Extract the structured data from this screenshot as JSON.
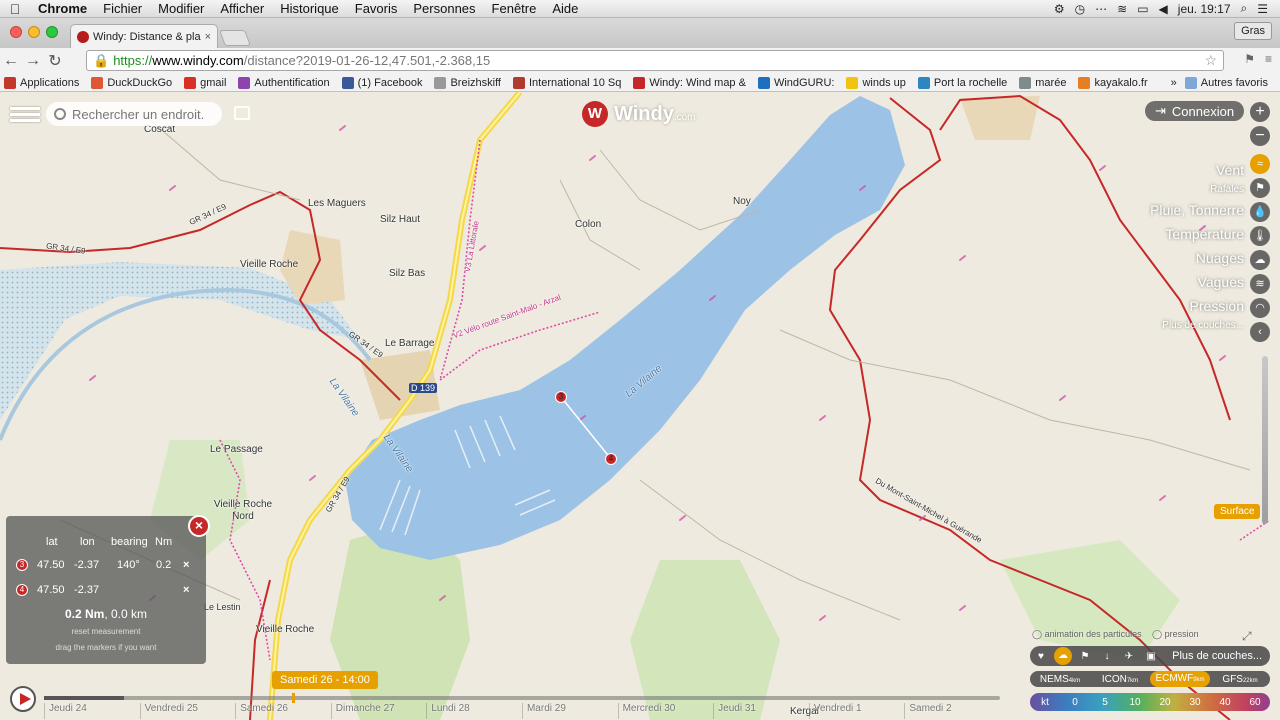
{
  "menubar": {
    "app": "Chrome",
    "items": [
      "Fichier",
      "Modifier",
      "Afficher",
      "Historique",
      "Favoris",
      "Personnes",
      "Fenêtre",
      "Aide"
    ],
    "clock": "jeu. 19:17"
  },
  "browser": {
    "tab_title": "Windy: Distance & planific",
    "profile_button": "Gras",
    "url_https": "https://",
    "url_host": "www.windy.com",
    "url_path": "/distance?2019-01-26-12,47.501,-2.368,15",
    "bookmarks": [
      {
        "label": "Applications",
        "color": "#c0392b"
      },
      {
        "label": "DuckDuckGo",
        "color": "#de5833"
      },
      {
        "label": "gmail",
        "color": "#d93025"
      },
      {
        "label": "Authentification",
        "color": "#8e44ad"
      },
      {
        "label": "(1) Facebook",
        "color": "#3b5998"
      },
      {
        "label": "Breizhskiff",
        "color": "#999999"
      },
      {
        "label": "International 10 Sq",
        "color": "#b03a2e"
      },
      {
        "label": "Windy: Wind map &",
        "color": "#c62828"
      },
      {
        "label": "WindGURU:",
        "color": "#1f6fbf"
      },
      {
        "label": "winds up",
        "color": "#f1c40f"
      },
      {
        "label": "Port la rochelle",
        "color": "#2e86c1"
      },
      {
        "label": "marée",
        "color": "#7f8c8d"
      },
      {
        "label": "kayakalo.fr",
        "color": "#e67e22"
      }
    ],
    "more_bookmarks": "»",
    "other_bookmarks": "Autres favoris"
  },
  "windy": {
    "search_placeholder": "Rechercher un endroit.",
    "logo_main": "Windy",
    "logo_suffix": ".com",
    "login": "Connexion",
    "layers": [
      {
        "label": "Vent",
        "small": false
      },
      {
        "label": "Rafales",
        "small": true
      },
      {
        "label": "Pluie, Tonnerre",
        "small": false
      },
      {
        "label": "Température",
        "small": false
      },
      {
        "label": "Nuages",
        "small": false
      },
      {
        "label": "Vagues",
        "small": false
      },
      {
        "label": "Pression",
        "small": false
      },
      {
        "label": "Plus de couches...",
        "small": true
      }
    ],
    "surface": "Surface",
    "measure": {
      "headers": {
        "lat": "lat",
        "lon": "lon",
        "bearing": "bearing",
        "nm": "Nm"
      },
      "rows": [
        {
          "n": "3",
          "lat": "47.50",
          "lon": "-2.37",
          "bearing": "140°",
          "nm": "0.2",
          "x": "×"
        },
        {
          "n": "4",
          "lat": "47.50",
          "lon": "-2.37",
          "bearing": "",
          "nm": "",
          "x": "×"
        }
      ],
      "total_nm": "0.2 Nm",
      "total_km": ", 0.0 km",
      "reset": "reset measurement",
      "drag": "drag the markers if you want",
      "close": "×"
    },
    "date_bubble": "Samedi 26 - 14:00",
    "days": [
      "Jeudi 24",
      "Vendredi 25",
      "Samedi 26",
      "Dimanche 27",
      "Lundi 28",
      "Mardi 29",
      "Mercredi 30",
      "Jeudi 31",
      "Vendredi 1",
      "Samedi 2"
    ],
    "particles_label": "animation des particules",
    "pressure_label": "pression",
    "more_layers": "Plus de couches...",
    "models": [
      {
        "name": "NEMS",
        "res": "4km",
        "active": false
      },
      {
        "name": "ICON",
        "res": "7km",
        "active": false
      },
      {
        "name": "ECMWF",
        "res": "9km",
        "active": true
      },
      {
        "name": "GFS",
        "res": "22km",
        "active": false
      }
    ],
    "scale_unit": "kt",
    "scale": [
      "0",
      "5",
      "10",
      "20",
      "30",
      "40",
      "60"
    ]
  },
  "map": {
    "places": [
      {
        "label": "Coscat"
      },
      {
        "label": "Les Maguers"
      },
      {
        "label": "Silz Haut"
      },
      {
        "label": "Colon"
      },
      {
        "label": "Noy"
      },
      {
        "label": "Vieille Roche"
      },
      {
        "label": "Silz Bas"
      },
      {
        "label": "Le Barrage"
      },
      {
        "label": "D 139"
      },
      {
        "label": "La Vilaine"
      },
      {
        "label": "La Vilaine"
      },
      {
        "label": "La Vilaine"
      },
      {
        "label": "Le Passage"
      },
      {
        "label": "Vieille Roche Nord"
      },
      {
        "label": "Le Lestin"
      },
      {
        "label": "Vieille Roche"
      },
      {
        "label": "Kergal"
      },
      {
        "label": "GR 34 / E9"
      },
      {
        "label": "GR 34 / E9"
      },
      {
        "label": "GR 34 / E9"
      },
      {
        "label": "GR 34 / E9"
      },
      {
        "label": "V2 Vélo route Saint-Malo - Arzal"
      },
      {
        "label": "V3 La Littorale"
      },
      {
        "label": "Du Mont-Saint-Michel à Guérande"
      }
    ],
    "markers": [
      "3",
      "4"
    ]
  }
}
